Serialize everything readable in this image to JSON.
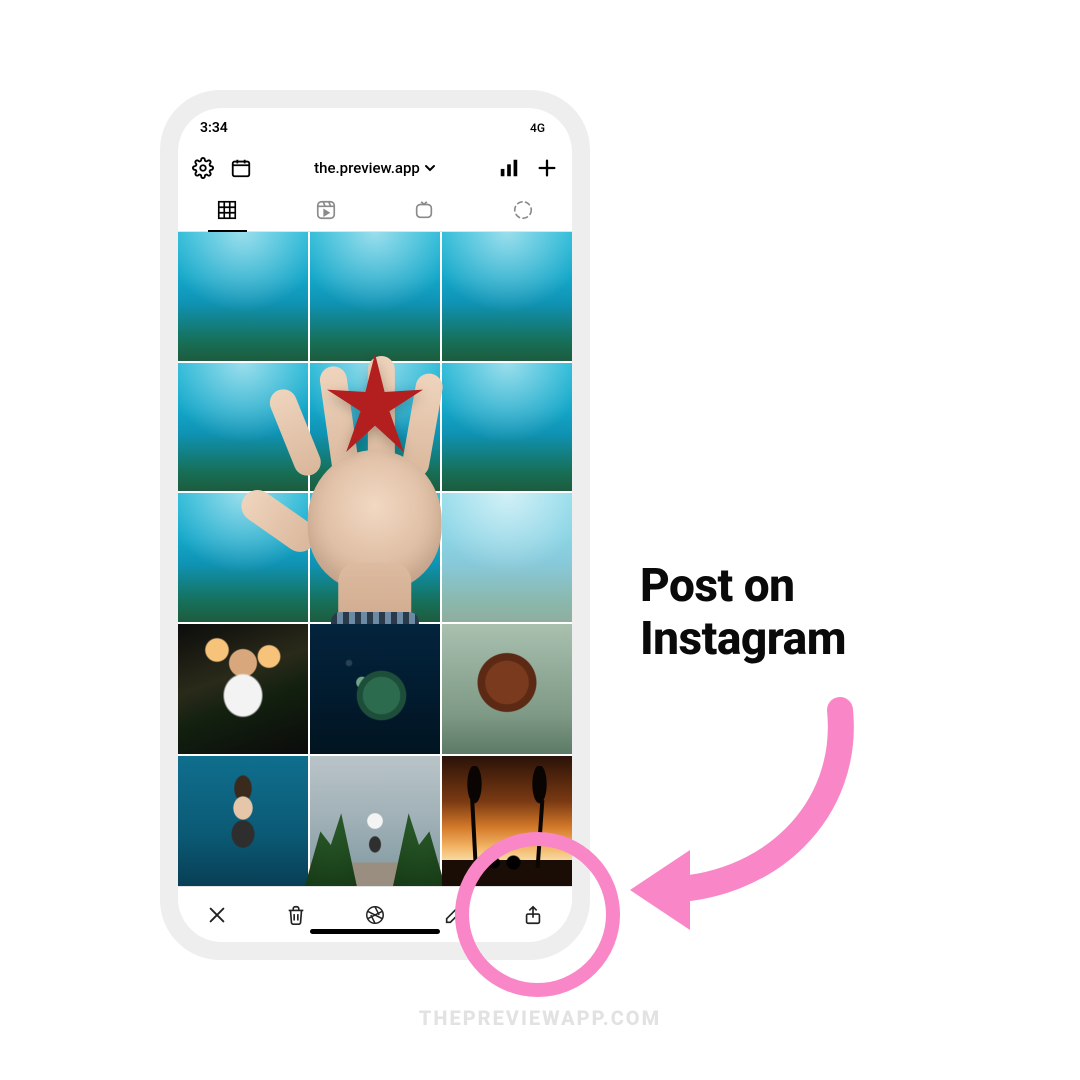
{
  "status": {
    "time": "3:34",
    "cellular": "4G"
  },
  "header": {
    "settings_icon": "gear-icon",
    "calendar_icon": "calendar-icon",
    "account_label": "the.preview.app",
    "analytics_icon": "analytics-icon",
    "add_icon": "plus-icon"
  },
  "tabs": {
    "grid": "grid-icon",
    "reels": "reels-icon",
    "igtv": "igtv-icon",
    "stories": "stories-ring-icon"
  },
  "bottom_toolbar": {
    "close": "close-icon",
    "trash": "trash-icon",
    "shutter": "shutter-icon",
    "edit": "edit-icon",
    "share": "share-icon"
  },
  "annotation": {
    "line1": "Post on",
    "line2": "Instagram"
  },
  "watermark": "THEPREVIEWAPP.COM"
}
